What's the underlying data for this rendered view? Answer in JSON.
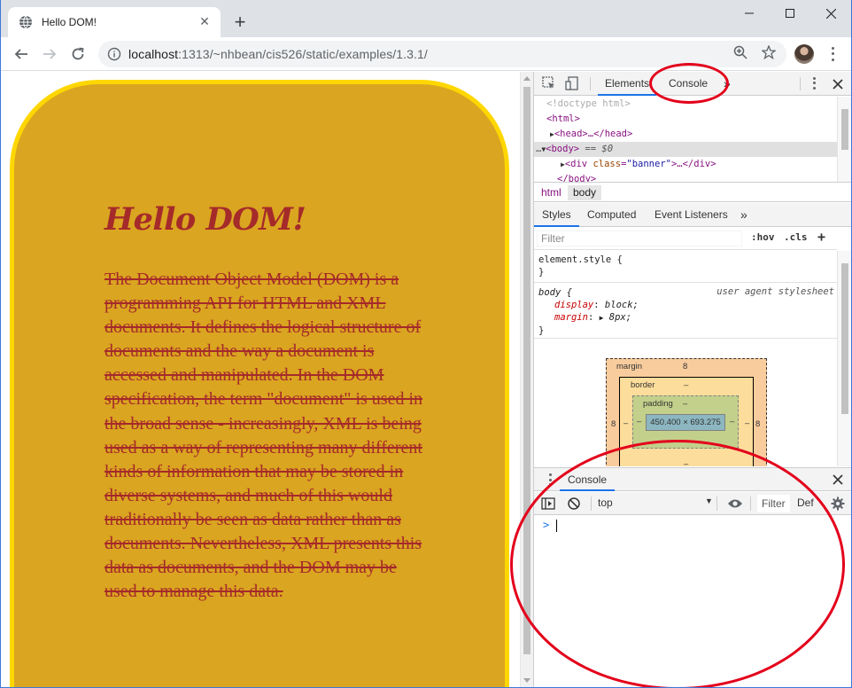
{
  "browser": {
    "tab_title": "Hello DOM!",
    "new_tab": "+",
    "url_host": "localhost",
    "url_rest": ":1313/~nhbean/cis526/static/examples/1.3.1/"
  },
  "page": {
    "heading": "Hello DOM!",
    "paragraph": "The Document Object Model (DOM) is a programming API for HTML and XML documents. It defines the logical structure of documents and the way a document is accessed and manipulated. In the DOM specification, the term \"document\" is used in the broad sense - increasingly, XML is being used as a way of representing many different kinds of information that may be stored in diverse systems, and much of this would traditionally be seen as data rather than as documents. Nevertheless, XML presents this data as documents, and the DOM may be used to manage this data.",
    "colors": {
      "banner_bg": "#daa520",
      "banner_border": "#ffd700",
      "text": "#a52a2a"
    }
  },
  "devtools": {
    "tabs": {
      "elements": "Elements",
      "console": "Console",
      "more": "»"
    },
    "dom": {
      "doctype": "<!doctype html>",
      "html_open": "<html>",
      "head_line": "<head>…</head>",
      "body_open": "<body>",
      "body_marker": "== $0",
      "div_tag": "<div",
      "div_attr": "class",
      "div_val": "\"banner\"",
      "div_rest": ">…</div>",
      "body_close": "</body>"
    },
    "breadcrumbs": [
      "html",
      "body"
    ],
    "subtabs": {
      "styles": "Styles",
      "computed": "Computed",
      "event_listeners": "Event Listeners",
      "more": "»"
    },
    "filter": {
      "placeholder": "Filter",
      "hov": ":hov",
      "cls": ".cls",
      "plus": "+"
    },
    "styles": {
      "element_style": "element.style {",
      "close": "}",
      "body_selector": "body {",
      "ua_label": "user agent stylesheet",
      "display_prop": "display",
      "display_val": "block;",
      "margin_prop": "margin",
      "margin_val": "8px;"
    },
    "box_model": {
      "margin_label": "margin",
      "margin_value": "8",
      "border_label": "border",
      "border_value": "–",
      "padding_label": "padding",
      "padding_value": "–",
      "content": "450.400 × 693.275",
      "side_left": "8",
      "side_right": "8",
      "dash": "–"
    },
    "drawer": {
      "tab": "Console",
      "context": "top",
      "filter": "Filter",
      "levels": "Def",
      "prompt": ">"
    }
  }
}
